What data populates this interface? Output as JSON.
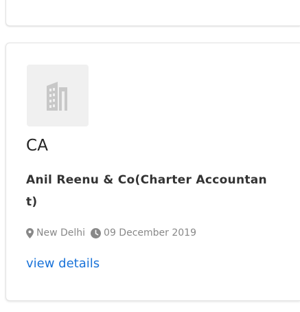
{
  "listing": {
    "category": "CA",
    "company_name": "Anil Reenu & Co(Charter Accountant)",
    "location": "New Delhi",
    "date": "09 December 2019",
    "details_link": "view details"
  },
  "icons": {
    "logo": "building-icon",
    "location": "map-marker-icon",
    "date": "clock-icon"
  },
  "colors": {
    "link": "#1a73d9",
    "meta_text": "#888888",
    "logo_bg": "#f0f0f0"
  }
}
